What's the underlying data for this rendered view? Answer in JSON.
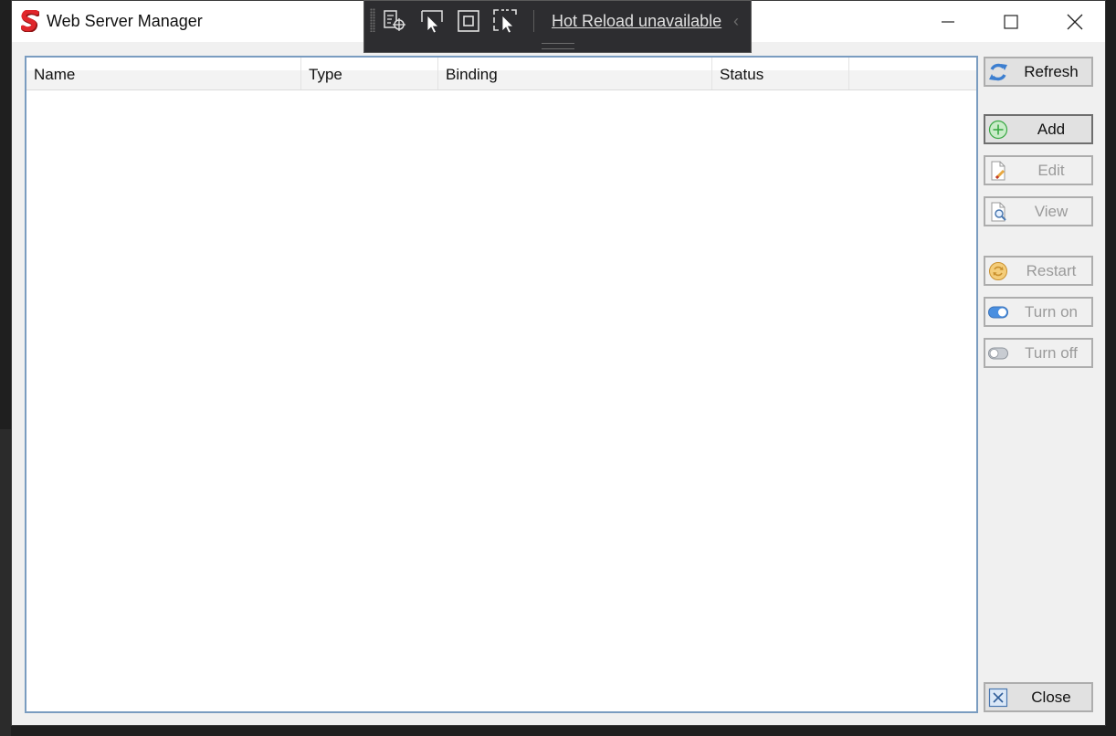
{
  "window": {
    "title": "Web Server Manager"
  },
  "hot_reload_toolbar": {
    "status_link": "Hot Reload unavailable"
  },
  "list": {
    "columns": [
      "Name",
      "Type",
      "Binding",
      "Status",
      ""
    ],
    "rows": []
  },
  "actions": {
    "refresh": "Refresh",
    "add": "Add",
    "edit": "Edit",
    "view": "View",
    "restart": "Restart",
    "turn_on": "Turn on",
    "turn_off": "Turn off",
    "close": "Close"
  },
  "colors": {
    "accent_border": "#7a9cc0",
    "logo_red": "#e0262b",
    "add_green": "#3aa845",
    "restart_orange": "#e8b040",
    "toggle_blue": "#4a8fe0"
  }
}
